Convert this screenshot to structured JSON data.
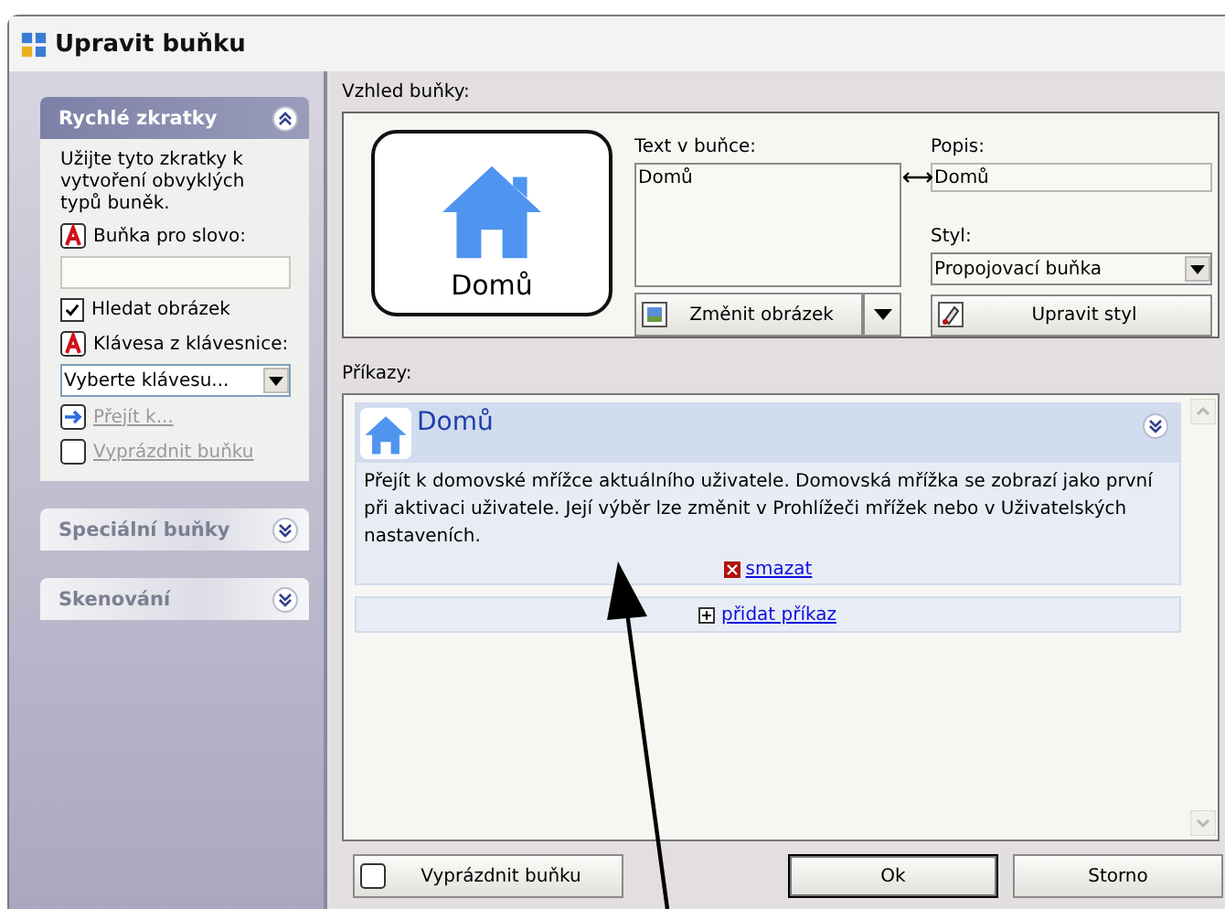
{
  "window": {
    "title": "Upravit buňku"
  },
  "sidebar": {
    "sections": [
      {
        "title": "Rychlé zkratky",
        "expanded": true
      },
      {
        "title": "Speciální buňky",
        "expanded": false
      },
      {
        "title": "Skenování",
        "expanded": false
      }
    ],
    "quick": {
      "intro": "Užijte tyto zkratky k vytvoření obvyklých typů buněk.",
      "word_label": "Buňka pro slovo:",
      "find_image": {
        "label": "Hledat obrázek",
        "checked": true
      },
      "key_label": "Klávesa z klávesnice:",
      "key_select": "Vyberte klávesu...",
      "goto": {
        "label": "Přejít k...",
        "disabled": true
      },
      "clear": {
        "label": "Vyprázdnit buňku",
        "disabled": true
      }
    }
  },
  "appearance": {
    "label": "Vzhled buňky:",
    "preview_text": "Domů",
    "text_label": "Text v buňce:",
    "text_value": "Domů",
    "desc_label": "Popis:",
    "desc_value": "Domů",
    "style_label": "Styl:",
    "style_value": "Propojovací buňka",
    "change_image": "Změnit obrázek",
    "edit_style": "Upravit styl"
  },
  "commands": {
    "label": "Příkazy:",
    "items": [
      {
        "title": "Domů",
        "description": "Přejít k domovské mřížce aktuálního uživatele. Domovská mřížka se zobrazí jako první při aktivaci uživatele. Její výběr lze změnit v Prohlížeči mřížek nebo v Uživatelských nastaveních.",
        "delete": "smazat"
      }
    ],
    "add": "přidat příkaz"
  },
  "buttons": {
    "clear": "Vyprázdnit buňku",
    "ok": "Ok",
    "cancel": "Storno"
  }
}
